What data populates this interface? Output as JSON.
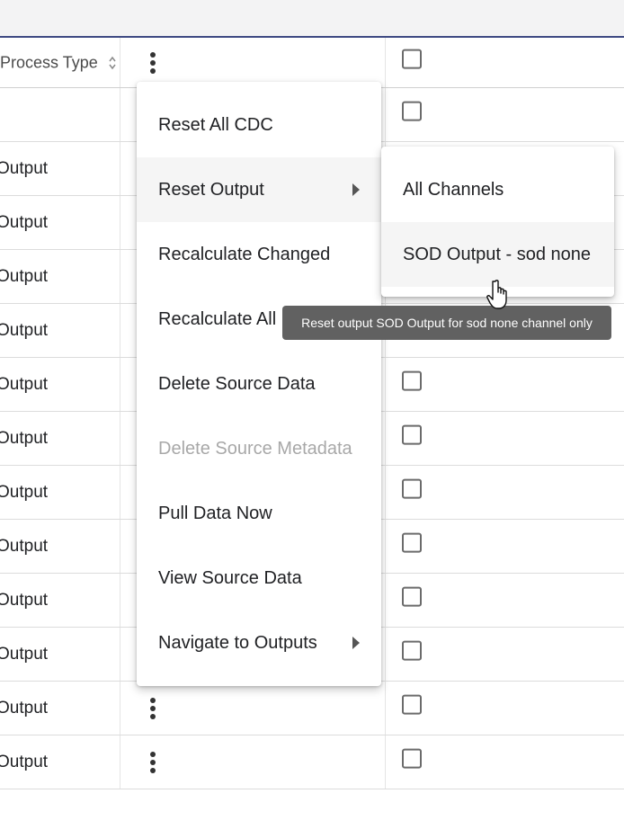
{
  "table": {
    "header": {
      "process_type_label": "Process Type"
    },
    "rows": [
      {
        "process_type": ""
      },
      {
        "process_type": "Output"
      },
      {
        "process_type": "Output"
      },
      {
        "process_type": "Output"
      },
      {
        "process_type": "Output"
      },
      {
        "process_type": "Output"
      },
      {
        "process_type": "Output"
      },
      {
        "process_type": "Output"
      },
      {
        "process_type": "Output"
      },
      {
        "process_type": "Output"
      },
      {
        "process_type": "Output"
      },
      {
        "process_type": "Output"
      },
      {
        "process_type": "Output"
      }
    ]
  },
  "context_menu": {
    "items": [
      {
        "label": "Reset All CDC"
      },
      {
        "label": "Reset Output"
      },
      {
        "label": "Recalculate Changed"
      },
      {
        "label": "Recalculate All"
      },
      {
        "label": "Delete Source Data"
      },
      {
        "label": "Delete Source Metadata"
      },
      {
        "label": "Pull Data Now"
      },
      {
        "label": "View Source Data"
      },
      {
        "label": "Navigate to Outputs"
      }
    ]
  },
  "submenu": {
    "items": [
      {
        "label": "All Channels"
      },
      {
        "label": "SOD Output - sod none"
      }
    ]
  },
  "tooltip": {
    "text": "Reset output SOD Output for sod none channel only"
  },
  "icons": {
    "sort": "sort-icon",
    "kebab": "more-vertical-icon",
    "checkbox": "checkbox-icon",
    "caret": "chevron-right-icon",
    "cursor": "hand-pointer-icon"
  },
  "colors": {
    "header_border": "#3e4a82",
    "tooltip_bg": "#616161",
    "hover_bg": "#f5f5f5",
    "disabled_text": "#a8a8a8"
  }
}
